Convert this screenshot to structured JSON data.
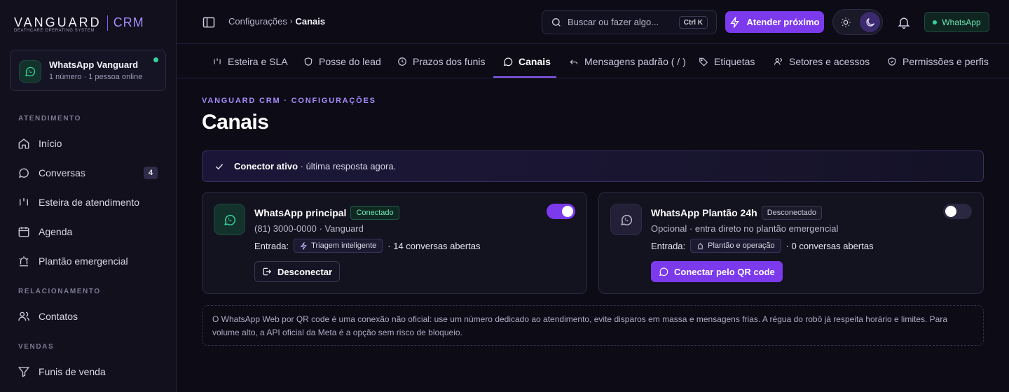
{
  "brand": {
    "name": "VANGUARD",
    "product": "CRM",
    "tagline": "DEATHCARE OPERATING SYSTEM"
  },
  "workspace": {
    "title": "WhatsApp Vanguard",
    "subtitle": "1 número · 1 pessoa online",
    "status_color": "#34d399"
  },
  "sidebar": {
    "sections": [
      {
        "label": "ATENDIMENTO"
      },
      {
        "label": "RELACIONAMENTO"
      },
      {
        "label": "VENDAS"
      }
    ],
    "items": [
      {
        "label": "Início",
        "icon": "home-icon"
      },
      {
        "label": "Conversas",
        "icon": "chat-bubble-icon",
        "badge": "4"
      },
      {
        "label": "Esteira de atendimento",
        "icon": "pipeline-icon"
      },
      {
        "label": "Agenda",
        "icon": "calendar-icon"
      },
      {
        "label": "Plantão emergencial",
        "icon": "siren-icon"
      },
      {
        "label": "Contatos",
        "icon": "users-icon"
      },
      {
        "label": "Funis de venda",
        "icon": "funnel-icon"
      }
    ]
  },
  "topbar": {
    "breadcrumb": {
      "parent": "Configurações",
      "current": "Canais"
    },
    "search": {
      "placeholder": "Buscar ou fazer algo...",
      "shortcut": "Ctrl K"
    },
    "primary_action": "Atender próximo",
    "whatsapp_status": "WhatsApp"
  },
  "tabs": [
    {
      "label": "Esteira e SLA",
      "icon": "pipeline-icon"
    },
    {
      "label": "Posse do lead",
      "icon": "shield-icon"
    },
    {
      "label": "Prazos dos funis",
      "icon": "clock-icon"
    },
    {
      "label": "Canais",
      "icon": "whatsapp-icon",
      "active": true
    },
    {
      "label": "Mensagens padrão ( / )",
      "icon": "reply-icon"
    },
    {
      "label": "Etiquetas",
      "icon": "tag-icon"
    },
    {
      "label": "Setores e acessos",
      "icon": "users-icon"
    },
    {
      "label": "Permissões e perfis",
      "icon": "shield-check-icon"
    }
  ],
  "page": {
    "eyebrow": "VANGUARD CRM · CONFIGURAÇÕES",
    "title": "Canais",
    "status_banner": {
      "strong": "Conector ativo",
      "text": " · última resposta agora."
    }
  },
  "channels": [
    {
      "name": "WhatsApp principal",
      "status": "Conectado",
      "subtitle": "(81) 3000-0000 · Vanguard",
      "entry_label": "Entrada:",
      "entry_chip": "Triagem inteligente",
      "open_count": "· 14 conversas abertas",
      "enabled": true,
      "action": "Desconectar"
    },
    {
      "name": "WhatsApp Plantão 24h",
      "status": "Desconectado",
      "subtitle": "Opcional · entra direto no plantão emergencial",
      "entry_label": "Entrada:",
      "entry_chip": "Plantão e operação",
      "open_count": "· 0 conversas abertas",
      "enabled": false,
      "action": "Conectar pelo QR code"
    }
  ],
  "notice": "O WhatsApp Web por QR code é uma conexão não oficial: use um número dedicado ao atendimento, evite disparos em massa e mensagens frias. A régua do robô já respeita horário e limites. Para volume alto, a API oficial da Meta é a opção sem risco de bloqueio.",
  "colors": {
    "accent": "#7c3aed",
    "accent_light": "#a78bfa",
    "success": "#34d399",
    "background": "#0c0b16"
  }
}
